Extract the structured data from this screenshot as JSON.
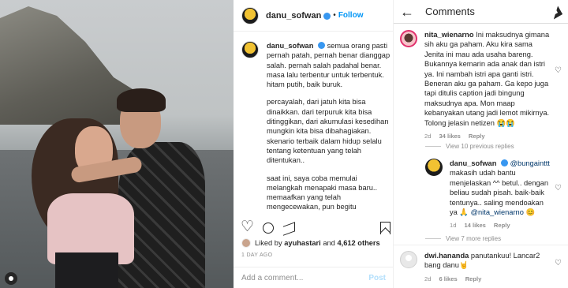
{
  "post": {
    "username": "danu_sofwan",
    "follow_label": "Follow",
    "dot": "•",
    "more_label": "•••",
    "caption_user": "danu_sofwan",
    "caption_lines": [
      "semua orang pasti pernah patah, pernah benar dianggap salah. pernah salah padahal benar. masa lalu terbentur untuk terbentuk. hitam putih, baik buruk.",
      "percayalah, dari jatuh kita bisa dinaikkan. dari terpuruk kita bisa ditinggikan, dari akumulasi kesedihan mungkin kita bisa dibahagiakan. skenario terbaik dalam hidup selalu tentang ketentuan yang telah ditentukan..",
      "saat ini, saya coba memulai melangkah menapaki masa baru.. memaafkan yang telah mengecewakan, pun begitu sebaliknya"
    ],
    "liked_by_prefix": "Liked by ",
    "liked_by_user": "ayuhastari",
    "liked_by_mid": " and ",
    "liked_by_count": "4,612 others",
    "time_ago": "1 DAY AGO",
    "add_comment_placeholder": "Add a comment...",
    "post_label": "Post"
  },
  "comments_panel": {
    "title": "Comments",
    "back_icon": "←",
    "items": [
      {
        "user": "nita_wienarno",
        "text": "Ini maksudnya gimana sih aku ga paham. Aku kira sama Jenita ini mau ada usaha bareng. Bukannya kemarin ada anak dan istri ya. Ini nambah istri apa ganti istri. Beneran aku ga paham. Ga kepo juga tapi ditulis caption jadi bingung maksudnya apa. Mon maap kebanyakan utang jadi lemot mikirnya. Tolong jelasin netizen 😭😭",
        "age": "2d",
        "likes": "34 likes",
        "reply": "Reply"
      },
      {
        "user": "danu_sofwan",
        "mention": "@bungainttt",
        "text": "makasih udah bantu menjelaskan ^^ betul.. dengan beliau sudah pisah. baik-baik tentunya.. saling mendoakan ya 🙏",
        "mention2": "@nita_wienarno",
        "tail": " 😊",
        "age": "1d",
        "likes": "14 likes",
        "reply": "Reply"
      },
      {
        "user": "dwi.hananda",
        "text": "panutankuu! Lancar2 bang danu🤘",
        "age": "2d",
        "likes": "6 likes",
        "reply": "Reply"
      }
    ],
    "view_replies_1": "View 10 previous replies",
    "view_replies_2": "View 7 more replies"
  }
}
